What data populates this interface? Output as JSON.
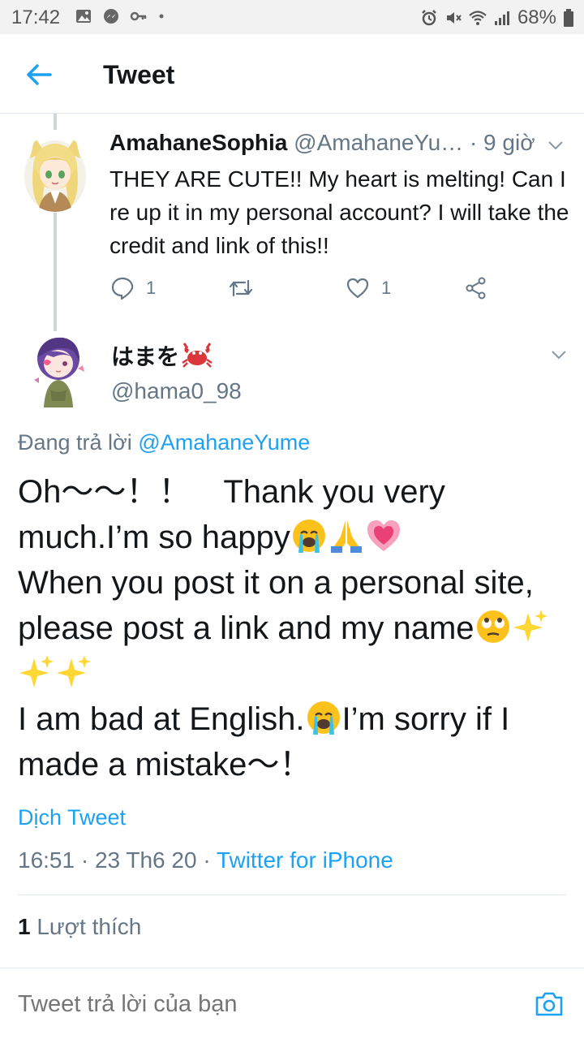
{
  "status_bar": {
    "time": "17:42",
    "battery": "68%",
    "icons": [
      "gallery-icon",
      "messenger-icon",
      "key-icon",
      "alarm-icon",
      "mute-icon",
      "wifi-icon",
      "signal-icon",
      "battery-icon"
    ]
  },
  "header": {
    "title": "Tweet"
  },
  "reply_tweet": {
    "name": "AmahaneSophia",
    "handle": "@AmahaneYu…",
    "time": "· 9 giờ",
    "text": "THEY ARE CUTE!! My heart is melting! Can I re up it in my personal account? I will take the credit and link of this!!",
    "reply_count": "1",
    "like_count": "1"
  },
  "main_tweet": {
    "name": "はまを",
    "name_emoji": "crab-emoji",
    "handle": "@hama0_98",
    "replying_prefix": "Đang trả lời",
    "replying_to": "@AmahaneYume",
    "line1": "Oh〜〜！！　Thank you very much.I’m so happy",
    "line2": "When you post it on a personal site, please post a link and my name",
    "line3a": "I am bad at English.",
    "line3b": "I’m sorry if I made a mistake〜！",
    "translate_label": "Dịch Tweet",
    "timestamp": "16:51 · 23 Th6 20 · ",
    "source": "Twitter for iPhone",
    "likes_count": "1",
    "likes_label": "Lượt thích"
  },
  "reply_bar": {
    "placeholder": "Tweet trả lời của bạn"
  },
  "colors": {
    "accent": "#1da1f2",
    "muted": "#657786",
    "text": "#14171a",
    "divider": "#e1e8ed"
  }
}
